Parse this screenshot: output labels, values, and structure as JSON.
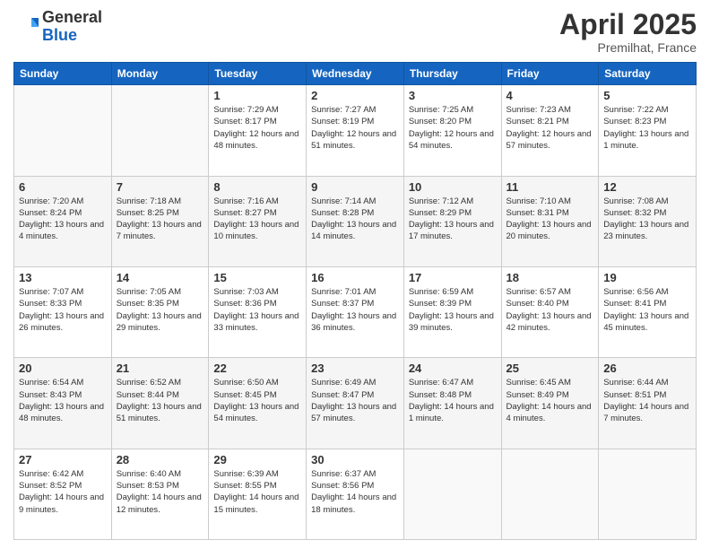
{
  "header": {
    "logo_general": "General",
    "logo_blue": "Blue",
    "title": "April 2025",
    "location": "Premilhat, France"
  },
  "days_of_week": [
    "Sunday",
    "Monday",
    "Tuesday",
    "Wednesday",
    "Thursday",
    "Friday",
    "Saturday"
  ],
  "weeks": [
    [
      null,
      null,
      {
        "day": 1,
        "sunrise": "7:29 AM",
        "sunset": "8:17 PM",
        "daylight": "12 hours and 48 minutes."
      },
      {
        "day": 2,
        "sunrise": "7:27 AM",
        "sunset": "8:19 PM",
        "daylight": "12 hours and 51 minutes."
      },
      {
        "day": 3,
        "sunrise": "7:25 AM",
        "sunset": "8:20 PM",
        "daylight": "12 hours and 54 minutes."
      },
      {
        "day": 4,
        "sunrise": "7:23 AM",
        "sunset": "8:21 PM",
        "daylight": "12 hours and 57 minutes."
      },
      {
        "day": 5,
        "sunrise": "7:22 AM",
        "sunset": "8:23 PM",
        "daylight": "13 hours and 1 minute."
      }
    ],
    [
      {
        "day": 6,
        "sunrise": "7:20 AM",
        "sunset": "8:24 PM",
        "daylight": "13 hours and 4 minutes."
      },
      {
        "day": 7,
        "sunrise": "7:18 AM",
        "sunset": "8:25 PM",
        "daylight": "13 hours and 7 minutes."
      },
      {
        "day": 8,
        "sunrise": "7:16 AM",
        "sunset": "8:27 PM",
        "daylight": "13 hours and 10 minutes."
      },
      {
        "day": 9,
        "sunrise": "7:14 AM",
        "sunset": "8:28 PM",
        "daylight": "13 hours and 14 minutes."
      },
      {
        "day": 10,
        "sunrise": "7:12 AM",
        "sunset": "8:29 PM",
        "daylight": "13 hours and 17 minutes."
      },
      {
        "day": 11,
        "sunrise": "7:10 AM",
        "sunset": "8:31 PM",
        "daylight": "13 hours and 20 minutes."
      },
      {
        "day": 12,
        "sunrise": "7:08 AM",
        "sunset": "8:32 PM",
        "daylight": "13 hours and 23 minutes."
      }
    ],
    [
      {
        "day": 13,
        "sunrise": "7:07 AM",
        "sunset": "8:33 PM",
        "daylight": "13 hours and 26 minutes."
      },
      {
        "day": 14,
        "sunrise": "7:05 AM",
        "sunset": "8:35 PM",
        "daylight": "13 hours and 29 minutes."
      },
      {
        "day": 15,
        "sunrise": "7:03 AM",
        "sunset": "8:36 PM",
        "daylight": "13 hours and 33 minutes."
      },
      {
        "day": 16,
        "sunrise": "7:01 AM",
        "sunset": "8:37 PM",
        "daylight": "13 hours and 36 minutes."
      },
      {
        "day": 17,
        "sunrise": "6:59 AM",
        "sunset": "8:39 PM",
        "daylight": "13 hours and 39 minutes."
      },
      {
        "day": 18,
        "sunrise": "6:57 AM",
        "sunset": "8:40 PM",
        "daylight": "13 hours and 42 minutes."
      },
      {
        "day": 19,
        "sunrise": "6:56 AM",
        "sunset": "8:41 PM",
        "daylight": "13 hours and 45 minutes."
      }
    ],
    [
      {
        "day": 20,
        "sunrise": "6:54 AM",
        "sunset": "8:43 PM",
        "daylight": "13 hours and 48 minutes."
      },
      {
        "day": 21,
        "sunrise": "6:52 AM",
        "sunset": "8:44 PM",
        "daylight": "13 hours and 51 minutes."
      },
      {
        "day": 22,
        "sunrise": "6:50 AM",
        "sunset": "8:45 PM",
        "daylight": "13 hours and 54 minutes."
      },
      {
        "day": 23,
        "sunrise": "6:49 AM",
        "sunset": "8:47 PM",
        "daylight": "13 hours and 57 minutes."
      },
      {
        "day": 24,
        "sunrise": "6:47 AM",
        "sunset": "8:48 PM",
        "daylight": "14 hours and 1 minute."
      },
      {
        "day": 25,
        "sunrise": "6:45 AM",
        "sunset": "8:49 PM",
        "daylight": "14 hours and 4 minutes."
      },
      {
        "day": 26,
        "sunrise": "6:44 AM",
        "sunset": "8:51 PM",
        "daylight": "14 hours and 7 minutes."
      }
    ],
    [
      {
        "day": 27,
        "sunrise": "6:42 AM",
        "sunset": "8:52 PM",
        "daylight": "14 hours and 9 minutes."
      },
      {
        "day": 28,
        "sunrise": "6:40 AM",
        "sunset": "8:53 PM",
        "daylight": "14 hours and 12 minutes."
      },
      {
        "day": 29,
        "sunrise": "6:39 AM",
        "sunset": "8:55 PM",
        "daylight": "14 hours and 15 minutes."
      },
      {
        "day": 30,
        "sunrise": "6:37 AM",
        "sunset": "8:56 PM",
        "daylight": "14 hours and 18 minutes."
      },
      null,
      null,
      null
    ]
  ]
}
